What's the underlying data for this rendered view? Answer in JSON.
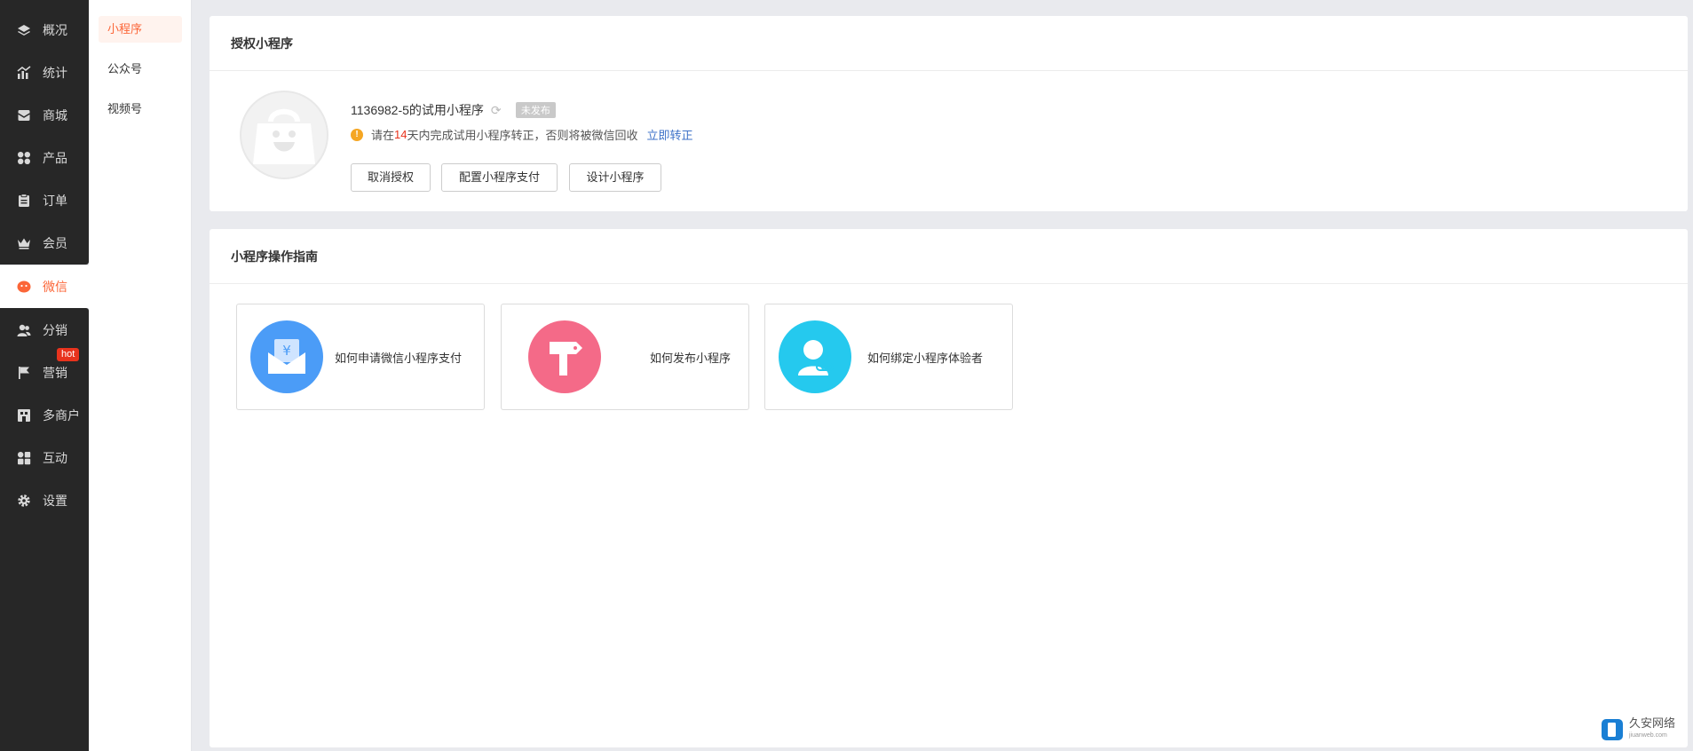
{
  "nav": {
    "items": [
      {
        "label": "概况",
        "icon": "layers-icon"
      },
      {
        "label": "统计",
        "icon": "chart-icon"
      },
      {
        "label": "商城",
        "icon": "mail-icon"
      },
      {
        "label": "产品",
        "icon": "grid-icon"
      },
      {
        "label": "订单",
        "icon": "clipboard-icon"
      },
      {
        "label": "会员",
        "icon": "crown-icon"
      },
      {
        "label": "微信",
        "icon": "wechat-icon",
        "active": true
      },
      {
        "label": "分销",
        "icon": "users-icon"
      },
      {
        "label": "营销",
        "icon": "flag-icon"
      },
      {
        "label": "多商户",
        "icon": "store-icon"
      },
      {
        "label": "互动",
        "icon": "apps-icon"
      },
      {
        "label": "设置",
        "icon": "gear-icon"
      }
    ],
    "hot_badge": "hot"
  },
  "subnav": {
    "items": [
      "小程序",
      "公众号",
      "视频号"
    ]
  },
  "auth_card": {
    "title": "授权小程序",
    "app_name": "1136982-5的试用小程序",
    "status": "未发布",
    "notice_prefix": "请在",
    "notice_days": "14",
    "notice_suffix": "天内完成试用小程序转正，否则将被微信回收",
    "notice_link": "立即转正",
    "buttons": [
      "取消授权",
      "配置小程序支付",
      "设计小程序"
    ]
  },
  "guide_card": {
    "title": "小程序操作指南",
    "items": [
      {
        "label": "如何申请微信小程序支付",
        "color": "#4b9cf7"
      },
      {
        "label": "如何发布小程序",
        "color": "#f46a88"
      },
      {
        "label": "如何绑定小程序体验者",
        "color": "#25c9ee"
      }
    ]
  },
  "watermark": {
    "name": "久安网络",
    "domain": "jiuanweb.com"
  },
  "colors": {
    "accent": "#fb6638",
    "sidebar": "#272727",
    "link": "#3e72c8"
  }
}
